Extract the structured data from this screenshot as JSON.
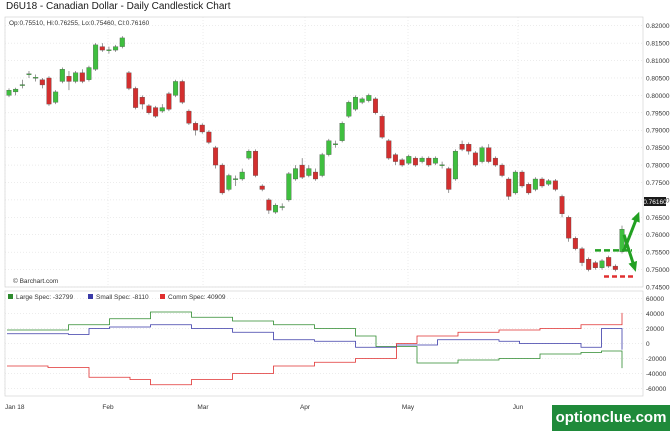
{
  "header": {
    "title": "D6U18 - Canadian Dollar - Daily Candlestick Chart",
    "ohlc": "Op:0.75510, Hi:0.76255, Lo:0.75460, Cl:0.76160",
    "price_tag": "0.76160",
    "source": "© Barchart.com"
  },
  "colors": {
    "up": "#3fbf3f",
    "down": "#d32f2f",
    "large": "#2e8b2e",
    "small": "#3a3aa8",
    "comm": "#e03030",
    "annotation": "#22a022",
    "dashed_down": "#e03030",
    "brand_bg": "#1f8a3a"
  },
  "watermark": "optionclue.com",
  "chart_data": [
    {
      "type": "candlestick",
      "title": "D6U18 - Canadian Dollar - Daily Candlestick Chart",
      "ylim": [
        0.745,
        0.8225
      ],
      "y_ticks": [
        "0.82000",
        "0.81500",
        "0.81000",
        "0.80500",
        "0.80000",
        "0.79500",
        "0.79000",
        "0.78500",
        "0.78000",
        "0.77500",
        "0.77000",
        "0.76500",
        "0.76000",
        "0.75500",
        "0.75000",
        "0.74500"
      ],
      "x_labels": [
        "Jan 18",
        "Feb",
        "Mar",
        "Apr",
        "May",
        "Jun"
      ],
      "last_price": 0.7616,
      "candles": [
        {
          "o": 0.8,
          "c": 0.8015,
          "h": 0.802,
          "l": 0.7995
        },
        {
          "o": 0.801,
          "c": 0.8018,
          "h": 0.8022,
          "l": 0.8
        },
        {
          "o": 0.803,
          "c": 0.8031,
          "h": 0.8045,
          "l": 0.802
        },
        {
          "o": 0.806,
          "c": 0.8062,
          "h": 0.807,
          "l": 0.805
        },
        {
          "o": 0.805,
          "c": 0.8052,
          "h": 0.806,
          "l": 0.804
        },
        {
          "o": 0.8045,
          "c": 0.803,
          "h": 0.805,
          "l": 0.802
        },
        {
          "o": 0.805,
          "c": 0.7975,
          "h": 0.8055,
          "l": 0.797
        },
        {
          "o": 0.798,
          "c": 0.801,
          "h": 0.8015,
          "l": 0.7975
        },
        {
          "o": 0.804,
          "c": 0.8075,
          "h": 0.808,
          "l": 0.8035
        },
        {
          "o": 0.8055,
          "c": 0.804,
          "h": 0.807,
          "l": 0.8015
        },
        {
          "o": 0.804,
          "c": 0.8065,
          "h": 0.807,
          "l": 0.8035
        },
        {
          "o": 0.8065,
          "c": 0.804,
          "h": 0.8075,
          "l": 0.8035
        },
        {
          "o": 0.8045,
          "c": 0.808,
          "h": 0.8085,
          "l": 0.804
        },
        {
          "o": 0.8075,
          "c": 0.8145,
          "h": 0.815,
          "l": 0.807
        },
        {
          "o": 0.814,
          "c": 0.813,
          "h": 0.815,
          "l": 0.8125
        },
        {
          "o": 0.813,
          "c": 0.8131,
          "h": 0.814,
          "l": 0.812
        },
        {
          "o": 0.813,
          "c": 0.814,
          "h": 0.8145,
          "l": 0.8125
        },
        {
          "o": 0.814,
          "c": 0.8165,
          "h": 0.817,
          "l": 0.8135
        },
        {
          "o": 0.8065,
          "c": 0.802,
          "h": 0.807,
          "l": 0.8015
        },
        {
          "o": 0.802,
          "c": 0.7965,
          "h": 0.8025,
          "l": 0.796
        },
        {
          "o": 0.7995,
          "c": 0.7975,
          "h": 0.8,
          "l": 0.796
        },
        {
          "o": 0.797,
          "c": 0.795,
          "h": 0.7975,
          "l": 0.7945
        },
        {
          "o": 0.7965,
          "c": 0.794,
          "h": 0.797,
          "l": 0.7935
        },
        {
          "o": 0.7955,
          "c": 0.7965,
          "h": 0.7975,
          "l": 0.795
        },
        {
          "o": 0.8005,
          "c": 0.796,
          "h": 0.801,
          "l": 0.7955
        },
        {
          "o": 0.8,
          "c": 0.804,
          "h": 0.8045,
          "l": 0.7995
        },
        {
          "o": 0.804,
          "c": 0.798,
          "h": 0.8045,
          "l": 0.7975
        },
        {
          "o": 0.7955,
          "c": 0.792,
          "h": 0.796,
          "l": 0.7915
        },
        {
          "o": 0.792,
          "c": 0.79,
          "h": 0.7925,
          "l": 0.7885
        },
        {
          "o": 0.7915,
          "c": 0.7895,
          "h": 0.792,
          "l": 0.789
        },
        {
          "o": 0.7895,
          "c": 0.7865,
          "h": 0.79,
          "l": 0.786
        },
        {
          "o": 0.785,
          "c": 0.78,
          "h": 0.7855,
          "l": 0.779
        },
        {
          "o": 0.78,
          "c": 0.772,
          "h": 0.7805,
          "l": 0.7715
        },
        {
          "o": 0.773,
          "c": 0.777,
          "h": 0.7775,
          "l": 0.7725
        },
        {
          "o": 0.776,
          "c": 0.7761,
          "h": 0.777,
          "l": 0.774
        },
        {
          "o": 0.776,
          "c": 0.778,
          "h": 0.779,
          "l": 0.7755
        },
        {
          "o": 0.782,
          "c": 0.784,
          "h": 0.7845,
          "l": 0.7815
        },
        {
          "o": 0.784,
          "c": 0.777,
          "h": 0.7845,
          "l": 0.7765
        },
        {
          "o": 0.774,
          "c": 0.773,
          "h": 0.7745,
          "l": 0.7725
        },
        {
          "o": 0.77,
          "c": 0.767,
          "h": 0.7705,
          "l": 0.766
        },
        {
          "o": 0.7665,
          "c": 0.7685,
          "h": 0.769,
          "l": 0.766
        },
        {
          "o": 0.768,
          "c": 0.7681,
          "h": 0.769,
          "l": 0.767
        },
        {
          "o": 0.77,
          "c": 0.7775,
          "h": 0.778,
          "l": 0.7695
        },
        {
          "o": 0.776,
          "c": 0.779,
          "h": 0.78,
          "l": 0.7755
        },
        {
          "o": 0.78,
          "c": 0.7765,
          "h": 0.782,
          "l": 0.776
        },
        {
          "o": 0.777,
          "c": 0.779,
          "h": 0.78,
          "l": 0.7765
        },
        {
          "o": 0.778,
          "c": 0.776,
          "h": 0.779,
          "l": 0.7755
        },
        {
          "o": 0.777,
          "c": 0.783,
          "h": 0.7835,
          "l": 0.7765
        },
        {
          "o": 0.783,
          "c": 0.787,
          "h": 0.7875,
          "l": 0.7825
        },
        {
          "o": 0.786,
          "c": 0.7861,
          "h": 0.787,
          "l": 0.785
        },
        {
          "o": 0.787,
          "c": 0.792,
          "h": 0.7925,
          "l": 0.7865
        },
        {
          "o": 0.794,
          "c": 0.798,
          "h": 0.7985,
          "l": 0.7935
        },
        {
          "o": 0.796,
          "c": 0.7995,
          "h": 0.8,
          "l": 0.7955
        },
        {
          "o": 0.798,
          "c": 0.799,
          "h": 0.7995,
          "l": 0.7975
        },
        {
          "o": 0.7985,
          "c": 0.8,
          "h": 0.8005,
          "l": 0.798
        },
        {
          "o": 0.799,
          "c": 0.795,
          "h": 0.7995,
          "l": 0.7945
        },
        {
          "o": 0.794,
          "c": 0.788,
          "h": 0.7945,
          "l": 0.7875
        },
        {
          "o": 0.787,
          "c": 0.782,
          "h": 0.7875,
          "l": 0.7815
        },
        {
          "o": 0.783,
          "c": 0.781,
          "h": 0.7835,
          "l": 0.78
        },
        {
          "o": 0.7815,
          "c": 0.78,
          "h": 0.782,
          "l": 0.7795
        },
        {
          "o": 0.7805,
          "c": 0.7825,
          "h": 0.783,
          "l": 0.78
        },
        {
          "o": 0.782,
          "c": 0.78,
          "h": 0.7825,
          "l": 0.7795
        },
        {
          "o": 0.781,
          "c": 0.782,
          "h": 0.7825,
          "l": 0.7805
        },
        {
          "o": 0.782,
          "c": 0.78,
          "h": 0.7825,
          "l": 0.7795
        },
        {
          "o": 0.7805,
          "c": 0.782,
          "h": 0.7825,
          "l": 0.78
        },
        {
          "o": 0.78,
          "c": 0.7801,
          "h": 0.781,
          "l": 0.779
        },
        {
          "o": 0.779,
          "c": 0.773,
          "h": 0.7795,
          "l": 0.772
        },
        {
          "o": 0.776,
          "c": 0.784,
          "h": 0.7845,
          "l": 0.7755
        },
        {
          "o": 0.786,
          "c": 0.7845,
          "h": 0.787,
          "l": 0.784
        },
        {
          "o": 0.786,
          "c": 0.784,
          "h": 0.7865,
          "l": 0.783
        },
        {
          "o": 0.7835,
          "c": 0.78,
          "h": 0.784,
          "l": 0.7795
        },
        {
          "o": 0.781,
          "c": 0.785,
          "h": 0.7855,
          "l": 0.7805
        },
        {
          "o": 0.785,
          "c": 0.781,
          "h": 0.786,
          "l": 0.7805
        },
        {
          "o": 0.782,
          "c": 0.78,
          "h": 0.7825,
          "l": 0.7795
        },
        {
          "o": 0.78,
          "c": 0.777,
          "h": 0.7805,
          "l": 0.7765
        },
        {
          "o": 0.776,
          "c": 0.771,
          "h": 0.7765,
          "l": 0.77
        },
        {
          "o": 0.772,
          "c": 0.778,
          "h": 0.7785,
          "l": 0.7715
        },
        {
          "o": 0.778,
          "c": 0.774,
          "h": 0.7785,
          "l": 0.7735
        },
        {
          "o": 0.7745,
          "c": 0.772,
          "h": 0.775,
          "l": 0.7715
        },
        {
          "o": 0.773,
          "c": 0.776,
          "h": 0.7765,
          "l": 0.7725
        },
        {
          "o": 0.776,
          "c": 0.774,
          "h": 0.7765,
          "l": 0.7735
        },
        {
          "o": 0.7745,
          "c": 0.7755,
          "h": 0.776,
          "l": 0.774
        },
        {
          "o": 0.7755,
          "c": 0.773,
          "h": 0.776,
          "l": 0.7725
        },
        {
          "o": 0.771,
          "c": 0.766,
          "h": 0.7715,
          "l": 0.765
        },
        {
          "o": 0.765,
          "c": 0.759,
          "h": 0.7655,
          "l": 0.758
        },
        {
          "o": 0.759,
          "c": 0.756,
          "h": 0.7595,
          "l": 0.7555
        },
        {
          "o": 0.756,
          "c": 0.752,
          "h": 0.7565,
          "l": 0.751
        },
        {
          "o": 0.753,
          "c": 0.75,
          "h": 0.7535,
          "l": 0.7495
        },
        {
          "o": 0.752,
          "c": 0.7505,
          "h": 0.7525,
          "l": 0.75
        },
        {
          "o": 0.7505,
          "c": 0.7525,
          "h": 0.753,
          "l": 0.75
        },
        {
          "o": 0.7535,
          "c": 0.751,
          "h": 0.754,
          "l": 0.7505
        },
        {
          "o": 0.751,
          "c": 0.75,
          "h": 0.7515,
          "l": 0.7495
        },
        {
          "o": 0.7551,
          "c": 0.7616,
          "h": 0.7626,
          "l": 0.7546
        }
      ]
    },
    {
      "type": "line",
      "title": "",
      "legend": [
        "Large Spec: -32799",
        "Small Spec: -8110",
        "Comm Spec: 40909"
      ],
      "ylim": [
        -70000,
        70000
      ],
      "y_ticks": [
        "60000",
        "40000",
        "20000",
        "0",
        "-20000",
        "-40000",
        "-60000"
      ],
      "series": [
        {
          "name": "Large Spec",
          "values": [
            18000,
            18000,
            18000,
            25000,
            25000,
            33000,
            33000,
            42000,
            42000,
            35000,
            35000,
            30000,
            30000,
            25000,
            25000,
            20000,
            20000,
            10000,
            -4000,
            -4000,
            -26000,
            -26000,
            -22000,
            -22000,
            -20000,
            -20000,
            -14000,
            -14000,
            -12000,
            -10000,
            -32799
          ]
        },
        {
          "name": "Small Spec",
          "values": [
            13000,
            13000,
            13000,
            12000,
            20000,
            22000,
            22000,
            25000,
            25000,
            20000,
            20000,
            15000,
            15000,
            5000,
            5000,
            3000,
            3000,
            -5000,
            -5000,
            -2000,
            -2000,
            5000,
            5000,
            5000,
            3000,
            0,
            0,
            0,
            -5000,
            20000,
            -8110
          ]
        },
        {
          "name": "Comm Spec",
          "values": [
            -30000,
            -30000,
            -32000,
            -32000,
            -45000,
            -45000,
            -48000,
            -55000,
            -55000,
            -48000,
            -48000,
            -40000,
            -40000,
            -30000,
            -30000,
            -25000,
            -25000,
            -20000,
            -20000,
            0,
            10000,
            10000,
            15000,
            15000,
            18000,
            18000,
            20000,
            20000,
            25000,
            25000,
            40909
          ]
        }
      ]
    }
  ]
}
